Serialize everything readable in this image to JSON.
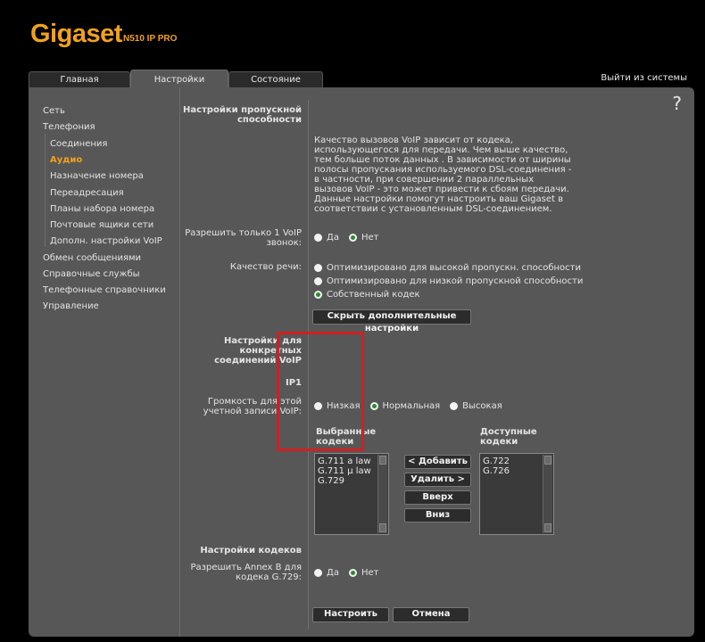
{
  "brand": {
    "name": "Gigaset",
    "model": "N510 IP PRO",
    "color": "#f0a21c"
  },
  "tabs": [
    {
      "label": "Главная"
    },
    {
      "label": "Настройки"
    },
    {
      "label": "Состояние"
    }
  ],
  "active_tab": "Настройки",
  "logout_label": "Выйти из системы",
  "help_label": "?",
  "sidebar": {
    "items": [
      {
        "label": "Сеть"
      },
      {
        "label": "Телефония"
      },
      {
        "label": "Соединения"
      },
      {
        "label": "Аудио"
      },
      {
        "label": "Назначение номера"
      },
      {
        "label": "Переадресация"
      },
      {
        "label": "Планы набора номера"
      },
      {
        "label": "Почтовые ящики сети"
      },
      {
        "label": "Дополн. настройки VoIP"
      },
      {
        "label": "Обмен сообщениями"
      },
      {
        "label": "Справочные службы"
      },
      {
        "label": "Телефонные справочники"
      },
      {
        "label": "Управление"
      }
    ],
    "active": "Аудио"
  },
  "bandwidth": {
    "title": "Настройки пропускной способности",
    "description": "Качество вызовов VoIP зависит от кодека, использующегося для передачи. Чем выше качество, тем больше поток данных . В зависимости от ширины полосы пропускания используемого DSL-соединения - в частности, при совершении 2 параллельных вызовов VoIP - это может привести к сбоям передачи. Данные настройки помогут настроить ваш Gigaset в соответствии с установленным DSL-соединением.",
    "one_call_label": "Разрешить только 1 VoIP звонок:",
    "one_call_options": [
      "Да",
      "Нет"
    ],
    "one_call_selected": "Нет",
    "quality_label": "Качество речи:",
    "quality_options": [
      "Оптимизировано для высокой пропускн. способности",
      "Оптимизировано для низкой пропускной способности",
      "Собственный кодек"
    ],
    "quality_selected": "Собственный кодек",
    "hide_button": "Скрыть дополнительные настройки"
  },
  "connection": {
    "title": "Настройки для конкретных соединений VoIP",
    "account": "IP1",
    "volume_label": "Громкость для этой учетной записи VoIP:",
    "volume_options": [
      "Низкая",
      "Нормальная",
      "Высокая"
    ],
    "volume_selected": "Нормальная",
    "selected_codecs_title": "Выбранные кодеки",
    "selected_codecs": [
      "G.711 a law",
      "G.711 μ law",
      "G.729"
    ],
    "available_codecs_title": "Доступные кодеки",
    "available_codecs": [
      "G.722",
      "G.726"
    ],
    "buttons": {
      "add": "< Добавить",
      "remove": "Удалить >",
      "up": "Вверх",
      "down": "Вниз"
    }
  },
  "codec_settings": {
    "title": "Настройки кодеков",
    "annexb_label": "Разрешить Annex B для кодека G.729:",
    "annexb_options": [
      "Да",
      "Нет"
    ],
    "annexb_selected": "Нет"
  },
  "footer": {
    "apply": "Настроить",
    "cancel": "Отмена"
  },
  "colors": {
    "panel": "#575757",
    "highlight": "#d21f1f",
    "radio_on": "#2d8a2d"
  }
}
